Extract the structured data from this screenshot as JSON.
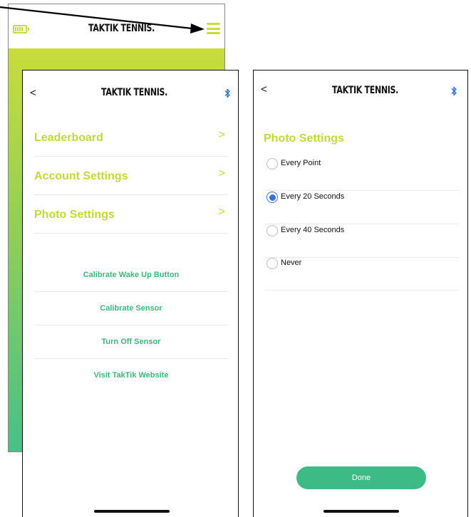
{
  "brand": "TAKTIK TENNIS.",
  "colors": {
    "lime": "#c3d93b",
    "green": "#3dba86",
    "radio_blue": "#3a74d6"
  },
  "background_screen": {
    "icons": [
      "battery-icon",
      "hamburger-menu-icon"
    ]
  },
  "menu_screen": {
    "back_label": "<",
    "items": [
      {
        "label": "Leaderboard",
        "chevron": ">"
      },
      {
        "label": "Account Settings",
        "chevron": ">"
      },
      {
        "label": "Photo Settings",
        "chevron": ">"
      }
    ],
    "links": [
      "Calibrate Wake Up Button",
      "Calibrate Sensor",
      "Turn Off Sensor",
      "Visit TakTik Website"
    ]
  },
  "photo_screen": {
    "back_label": "<",
    "title": "Photo Settings",
    "options": [
      {
        "label": "Every Point",
        "selected": false
      },
      {
        "label": "Every 20 Seconds",
        "selected": true
      },
      {
        "label": "Every 40 Seconds",
        "selected": false
      },
      {
        "label": "Never",
        "selected": false
      }
    ],
    "done_label": "Done"
  }
}
